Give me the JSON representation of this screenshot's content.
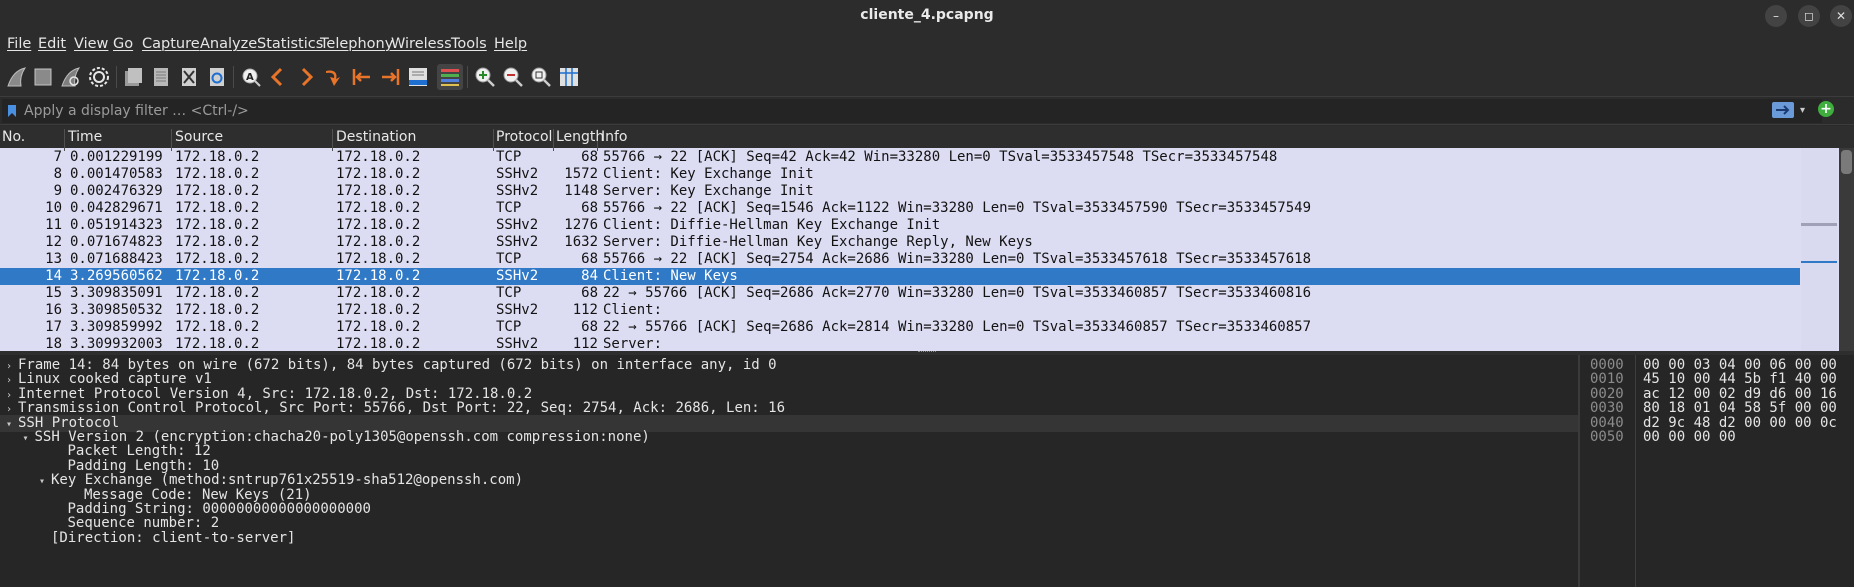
{
  "window": {
    "title": "cliente_4.pcapng",
    "minimize_label": "–",
    "maximize_label": "◻",
    "close_label": "✕"
  },
  "menu": [
    "File",
    "Edit",
    "View",
    "Go",
    "Capture",
    "Analyze",
    "Statistics",
    "Telephony",
    "Wireless",
    "Tools",
    "Help"
  ],
  "toolbar": {
    "icons": [
      "shark-fin-icon",
      "stop-square-icon",
      "restart-fin-icon",
      "gear-icon",
      "open-file-icon",
      "save-file-icon",
      "close-file-icon",
      "reload-icon",
      "find-icon",
      "back-arrow-icon",
      "forward-arrow-icon",
      "jump-icon",
      "first-packet-icon",
      "last-packet-icon",
      "autoscroll-icon",
      "colorize-icon",
      "zoom-in-icon",
      "zoom-out-icon",
      "zoom-reset-icon",
      "resize-columns-icon"
    ]
  },
  "filter": {
    "placeholder": "Apply a display filter … <Ctrl-/>"
  },
  "columns": [
    "No.",
    "Time",
    "Source",
    "Destination",
    "Protocol",
    "Length",
    "Info"
  ],
  "packets": [
    {
      "no": "7",
      "time": "0.001229199",
      "src": "172.18.0.2",
      "dst": "172.18.0.2",
      "proto": "TCP",
      "len": "68",
      "info": "55766 → 22 [ACK] Seq=42 Ack=42 Win=33280 Len=0 TSval=3533457548 TSecr=3533457548"
    },
    {
      "no": "8",
      "time": "0.001470583",
      "src": "172.18.0.2",
      "dst": "172.18.0.2",
      "proto": "SSHv2",
      "len": "1572",
      "info": "Client: Key Exchange Init"
    },
    {
      "no": "9",
      "time": "0.002476329",
      "src": "172.18.0.2",
      "dst": "172.18.0.2",
      "proto": "SSHv2",
      "len": "1148",
      "info": "Server: Key Exchange Init"
    },
    {
      "no": "10",
      "time": "0.042829671",
      "src": "172.18.0.2",
      "dst": "172.18.0.2",
      "proto": "TCP",
      "len": "68",
      "info": "55766 → 22 [ACK] Seq=1546 Ack=1122 Win=33280 Len=0 TSval=3533457590 TSecr=3533457549"
    },
    {
      "no": "11",
      "time": "0.051914323",
      "src": "172.18.0.2",
      "dst": "172.18.0.2",
      "proto": "SSHv2",
      "len": "1276",
      "info": "Client: Diffie-Hellman Key Exchange Init"
    },
    {
      "no": "12",
      "time": "0.071674823",
      "src": "172.18.0.2",
      "dst": "172.18.0.2",
      "proto": "SSHv2",
      "len": "1632",
      "info": "Server: Diffie-Hellman Key Exchange Reply, New Keys"
    },
    {
      "no": "13",
      "time": "0.071688423",
      "src": "172.18.0.2",
      "dst": "172.18.0.2",
      "proto": "TCP",
      "len": "68",
      "info": "55766 → 22 [ACK] Seq=2754 Ack=2686 Win=33280 Len=0 TSval=3533457618 TSecr=3533457618"
    },
    {
      "no": "14",
      "time": "3.269560562",
      "src": "172.18.0.2",
      "dst": "172.18.0.2",
      "proto": "SSHv2",
      "len": "84",
      "info": "Client: New Keys",
      "selected": true
    },
    {
      "no": "15",
      "time": "3.309835091",
      "src": "172.18.0.2",
      "dst": "172.18.0.2",
      "proto": "TCP",
      "len": "68",
      "info": "22 → 55766 [ACK] Seq=2686 Ack=2770 Win=33280 Len=0 TSval=3533460857 TSecr=3533460816"
    },
    {
      "no": "16",
      "time": "3.309850532",
      "src": "172.18.0.2",
      "dst": "172.18.0.2",
      "proto": "SSHv2",
      "len": "112",
      "info": "Client:"
    },
    {
      "no": "17",
      "time": "3.309859992",
      "src": "172.18.0.2",
      "dst": "172.18.0.2",
      "proto": "TCP",
      "len": "68",
      "info": "22 → 55766 [ACK] Seq=2686 Ack=2814 Win=33280 Len=0 TSval=3533460857 TSecr=3533460857"
    },
    {
      "no": "18",
      "time": "3.309932003",
      "src": "172.18.0.2",
      "dst": "172.18.0.2",
      "proto": "SSHv2",
      "len": "112",
      "info": "Server:"
    }
  ],
  "details": [
    {
      "text": "Frame 14: 84 bytes on wire (672 bits), 84 bytes captured (672 bits) on interface any, id 0",
      "indent": 0,
      "arrow": "right"
    },
    {
      "text": "Linux cooked capture v1",
      "indent": 0,
      "arrow": "right"
    },
    {
      "text": "Internet Protocol Version 4, Src: 172.18.0.2, Dst: 172.18.0.2",
      "indent": 0,
      "arrow": "right"
    },
    {
      "text": "Transmission Control Protocol, Src Port: 55766, Dst Port: 22, Seq: 2754, Ack: 2686, Len: 16",
      "indent": 0,
      "arrow": "right"
    },
    {
      "text": "SSH Protocol",
      "indent": 0,
      "arrow": "down",
      "hdr": true
    },
    {
      "text": "SSH Version 2 (encryption:chacha20-poly1305@openssh.com compression:none)",
      "indent": 1,
      "arrow": "down"
    },
    {
      "text": "Packet Length: 12",
      "indent": 3,
      "arrow": ""
    },
    {
      "text": "Padding Length: 10",
      "indent": 3,
      "arrow": ""
    },
    {
      "text": "Key Exchange (method:sntrup761x25519-sha512@openssh.com)",
      "indent": 2,
      "arrow": "down"
    },
    {
      "text": "Message Code: New Keys (21)",
      "indent": 4,
      "arrow": ""
    },
    {
      "text": "Padding String: 00000000000000000000",
      "indent": 3,
      "arrow": ""
    },
    {
      "text": "Sequence number: 2",
      "indent": 3,
      "arrow": ""
    },
    {
      "text": "[Direction: client-to-server]",
      "indent": 2,
      "arrow": ""
    }
  ],
  "bytes": [
    {
      "offset": "0000",
      "hex": "00 00 03 04 00 06 00 00"
    },
    {
      "offset": "0010",
      "hex": "45 10 00 44 5b f1 40 00"
    },
    {
      "offset": "0020",
      "hex": "ac 12 00 02 d9 d6 00 16"
    },
    {
      "offset": "0030",
      "hex": "80 18 01 04 58 5f 00 00"
    },
    {
      "offset": "0040",
      "hex": "d2 9c 48 d2 00 00 00 0c"
    },
    {
      "offset": "0050",
      "hex": "00 00 00 00"
    }
  ],
  "colors": {
    "selected_row": "#2f79c7",
    "packet_bg": "#dcdcf3",
    "add_filter": "#3fae3f",
    "arrow_orange": "#e8742a"
  }
}
